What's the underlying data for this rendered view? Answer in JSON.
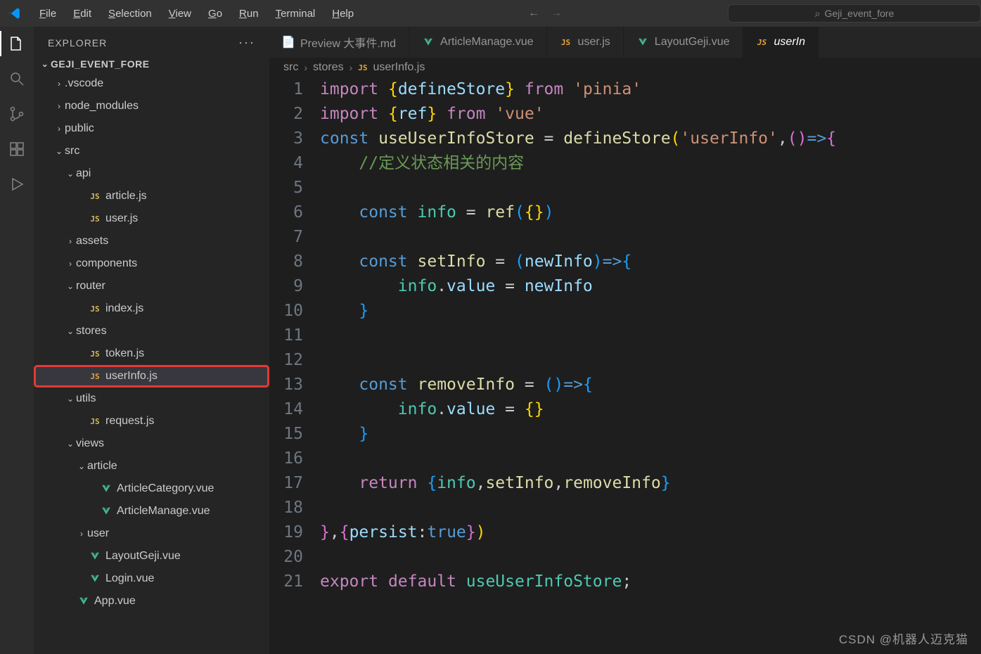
{
  "menu": {
    "items": [
      "File",
      "Edit",
      "Selection",
      "View",
      "Go",
      "Run",
      "Terminal",
      "Help"
    ]
  },
  "search": {
    "placeholder": "Geji_event_fore"
  },
  "sidebar": {
    "title": "EXPLORER",
    "project": "GEJI_EVENT_FORE",
    "tree": [
      {
        "indent": 1,
        "chev": ">",
        "label": ".vscode",
        "type": "folder"
      },
      {
        "indent": 1,
        "chev": ">",
        "label": "node_modules",
        "type": "folder"
      },
      {
        "indent": 1,
        "chev": ">",
        "label": "public",
        "type": "folder"
      },
      {
        "indent": 1,
        "chev": "v",
        "label": "src",
        "type": "folder"
      },
      {
        "indent": 2,
        "chev": "v",
        "label": "api",
        "type": "folder"
      },
      {
        "indent": 3,
        "chev": "",
        "label": "article.js",
        "type": "js"
      },
      {
        "indent": 3,
        "chev": "",
        "label": "user.js",
        "type": "js"
      },
      {
        "indent": 2,
        "chev": ">",
        "label": "assets",
        "type": "folder"
      },
      {
        "indent": 2,
        "chev": ">",
        "label": "components",
        "type": "folder"
      },
      {
        "indent": 2,
        "chev": "v",
        "label": "router",
        "type": "folder"
      },
      {
        "indent": 3,
        "chev": "",
        "label": "index.js",
        "type": "js"
      },
      {
        "indent": 2,
        "chev": "v",
        "label": "stores",
        "type": "folder"
      },
      {
        "indent": 3,
        "chev": "",
        "label": "token.js",
        "type": "js"
      },
      {
        "indent": 3,
        "chev": "",
        "label": "userInfo.js",
        "type": "js",
        "selected": true,
        "highlight": true
      },
      {
        "indent": 2,
        "chev": "v",
        "label": "utils",
        "type": "folder"
      },
      {
        "indent": 3,
        "chev": "",
        "label": "request.js",
        "type": "js"
      },
      {
        "indent": 2,
        "chev": "v",
        "label": "views",
        "type": "folder"
      },
      {
        "indent": 3,
        "chev": "v",
        "label": "article",
        "type": "folder"
      },
      {
        "indent": 4,
        "chev": "",
        "label": "ArticleCategory.vue",
        "type": "vue"
      },
      {
        "indent": 4,
        "chev": "",
        "label": "ArticleManage.vue",
        "type": "vue"
      },
      {
        "indent": 3,
        "chev": ">",
        "label": "user",
        "type": "folder"
      },
      {
        "indent": 3,
        "chev": "",
        "label": "LayoutGeji.vue",
        "type": "vue"
      },
      {
        "indent": 3,
        "chev": "",
        "label": "Login.vue",
        "type": "vue"
      },
      {
        "indent": 2,
        "chev": "",
        "label": "App.vue",
        "type": "vue"
      }
    ]
  },
  "tabs": [
    {
      "icon": "preview",
      "label": "Preview 大事件.md"
    },
    {
      "icon": "vue",
      "label": "ArticleManage.vue"
    },
    {
      "icon": "js",
      "label": "user.js"
    },
    {
      "icon": "vue",
      "label": "LayoutGeji.vue"
    },
    {
      "icon": "js",
      "label": "userInfo.js",
      "active": true,
      "italic": true,
      "truncated": "userIn"
    }
  ],
  "breadcrumb": {
    "parts": [
      "src",
      "stores",
      "userInfo.js"
    ],
    "last_icon": "js"
  },
  "code": {
    "lines": [
      1,
      2,
      3,
      4,
      5,
      6,
      7,
      8,
      9,
      10,
      11,
      12,
      13,
      14,
      15,
      16,
      17,
      18,
      19,
      20,
      21
    ],
    "tokens": {
      "l1": {
        "import": "import",
        "lb": "{",
        "defineStore": "defineStore",
        "rb": "}",
        "from": "from",
        "pinia": "'pinia'"
      },
      "l2": {
        "import": "import",
        "lb": "{",
        "ref": "ref",
        "rb": "}",
        "from": "from",
        "vue": "'vue'"
      },
      "l3": {
        "const": "const",
        "useStore": "useUserInfoStore",
        "eq": " = ",
        "defineStore": "defineStore",
        "lp": "(",
        "userInfo": "'userInfo'",
        "comma": ",",
        "lp2": "(",
        ")": ")",
        "arrow": "=>",
        "lb": "{"
      },
      "l4": {
        "comment": "//定义状态相关的内容"
      },
      "l6": {
        "const": "const",
        "info": "info",
        "eq": " = ",
        "ref": "ref",
        "lp": "(",
        "lb": "{",
        "rb": "}",
        "rp": ")"
      },
      "l8": {
        "const": "const",
        "setInfo": "setInfo",
        "eq": " = ",
        "lp": "(",
        "newInfo": "newInfo",
        "rp": ")",
        "arrow": "=>",
        "lb": "{"
      },
      "l9": {
        "info": "info",
        ".value": ".",
        "value": "value",
        "eq": " = ",
        "newInfo": "newInfo"
      },
      "l10": {
        "rb": "}"
      },
      "l13": {
        "const": "const",
        "removeInfo": "removeInfo",
        "eq": " = ",
        "lp": "(",
        "rp": ")",
        "arrow": "=>",
        "lb": "{"
      },
      "l14": {
        "info": "info",
        ".": ".",
        "value": "value",
        "eq": " = ",
        "lb": "{",
        "rb": "}"
      },
      "l15": {
        "rb": "}"
      },
      "l17": {
        "return": "return",
        "lb": "{",
        "info": "info",
        ",": ",",
        "setInfo": "setInfo",
        ",2": ",",
        "removeInfo": "removeInfo",
        "rb": "}"
      },
      "l19": {
        "rb": "}",
        ",": ",",
        "lb2": "{",
        "persist": "persist",
        ":": ":",
        "true": "true",
        "rb2": "}",
        "rp": ")"
      },
      "l21": {
        "export": "export",
        "default": "default",
        "useStore": "useUserInfoStore",
        ";": ";"
      }
    }
  },
  "watermark": "CSDN @机器人迈克猫"
}
